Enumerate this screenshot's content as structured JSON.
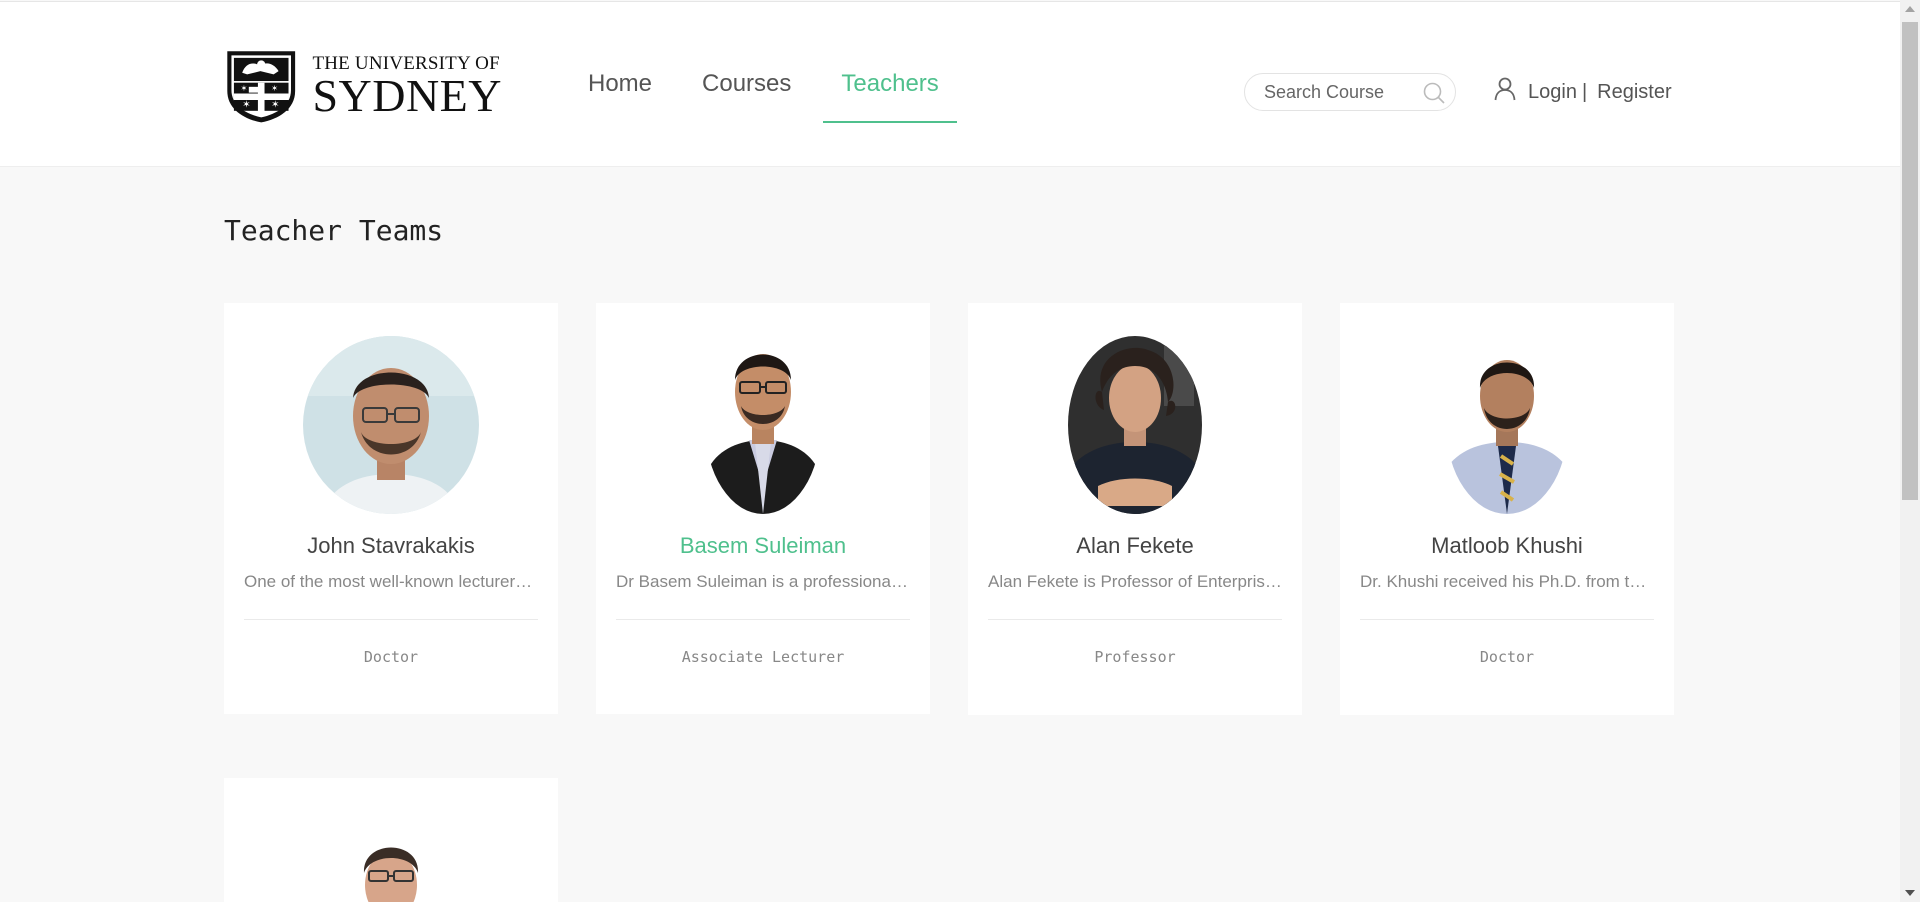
{
  "header": {
    "logo": {
      "line1": "THE UNIVERSITY OF",
      "line2": "SYDNEY"
    },
    "nav": [
      {
        "label": "Home"
      },
      {
        "label": "Courses"
      },
      {
        "label": "Teachers",
        "active": true
      }
    ],
    "search": {
      "placeholder": "Search Course"
    },
    "account": {
      "login": "Login",
      "separator": "|",
      "register": "Register"
    }
  },
  "page": {
    "title": "Teacher Teams"
  },
  "teachers": [
    {
      "name": "John Stavrakakis",
      "desc": "One of the most well-known lecturers in the School of Computer Science",
      "role": "Doctor"
    },
    {
      "name": "Basem Suleiman",
      "desc": "Dr Basem Suleiman is a professional lecturer in the School of Computer Science",
      "role": "Associate Lecturer",
      "highlight": true
    },
    {
      "name": "Alan Fekete",
      "desc": "Alan Fekete is Professor of Enterprise Software Systems",
      "role": "Professor"
    },
    {
      "name": "Matloob Khushi",
      "desc": "Dr. Khushi received his Ph.D. from the University of Sydney",
      "role": "Doctor"
    },
    {
      "name": "",
      "desc": "",
      "role": ""
    }
  ],
  "colors": {
    "accent": "#4fc08d",
    "text": "#555555",
    "background": "#f8f8f8"
  }
}
